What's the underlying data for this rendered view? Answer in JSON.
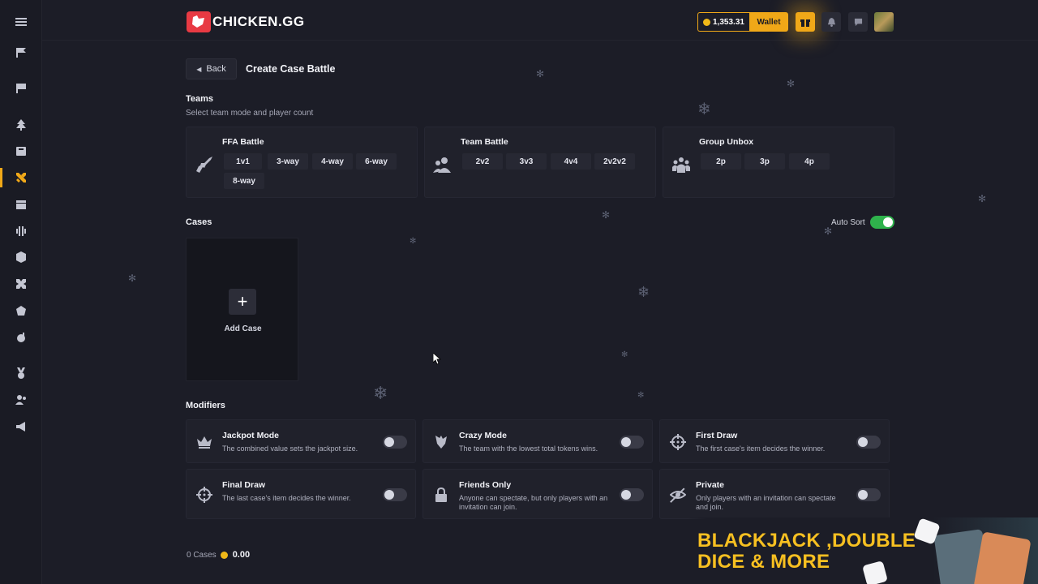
{
  "header": {
    "logo_text": "CHICKEN.GG",
    "balance": "1,353.31",
    "wallet_label": "Wallet"
  },
  "sidebar": {
    "items": [
      "menu-icon",
      "flag-icon",
      "flag-icon",
      "tree-icon",
      "box-icon",
      "swords-icon",
      "store-icon",
      "chart-icon",
      "cube-icon",
      "crosshair-icon",
      "tag-icon",
      "bomb-icon",
      "medal-icon",
      "users-icon",
      "megaphone-icon"
    ],
    "active_index": 5
  },
  "page": {
    "back_label": "Back",
    "title": "Create Case Battle"
  },
  "teams": {
    "title": "Teams",
    "subtitle": "Select team mode and player count",
    "modes": [
      {
        "title": "FFA Battle",
        "icon": "rifle-icon",
        "options": [
          "1v1",
          "3-way",
          "4-way",
          "6-way",
          "8-way"
        ]
      },
      {
        "title": "Team Battle",
        "icon": "team-icon",
        "options": [
          "2v2",
          "3v3",
          "4v4",
          "2v2v2"
        ]
      },
      {
        "title": "Group Unbox",
        "icon": "group-icon",
        "options": [
          "2p",
          "3p",
          "4p"
        ]
      }
    ]
  },
  "cases": {
    "title": "Cases",
    "auto_sort_label": "Auto Sort",
    "auto_sort_on": true,
    "add_case_label": "Add Case"
  },
  "modifiers": {
    "title": "Modifiers",
    "items": [
      {
        "title": "Jackpot Mode",
        "desc": "The combined value sets the jackpot size.",
        "icon": "crown-icon",
        "on": false
      },
      {
        "title": "Crazy Mode",
        "desc": "The team with the lowest total tokens wins.",
        "icon": "chicken-icon",
        "on": false
      },
      {
        "title": "First Draw",
        "desc": "The first case's item decides the winner.",
        "icon": "crosshair-icon",
        "on": false
      },
      {
        "title": "Final Draw",
        "desc": "The last case's item decides the winner.",
        "icon": "crosshair-icon",
        "on": false
      },
      {
        "title": "Friends Only",
        "desc": "Anyone can spectate, but only players with an invitation can join.",
        "icon": "lock-icon",
        "on": false
      },
      {
        "title": "Private",
        "desc": "Only players with an invitation can spectate and join.",
        "icon": "eye-off-icon",
        "on": false
      }
    ]
  },
  "footer": {
    "cases_count": "0 Cases",
    "total": "0.00"
  },
  "promo": {
    "line1": "BLACKJACK ,DOUBLE",
    "line2": "DICE & MORE"
  },
  "colors": {
    "accent": "#f0a818",
    "background": "#1c1d27",
    "toggle_on": "#2fb24c",
    "brand_red": "#e83a43"
  }
}
